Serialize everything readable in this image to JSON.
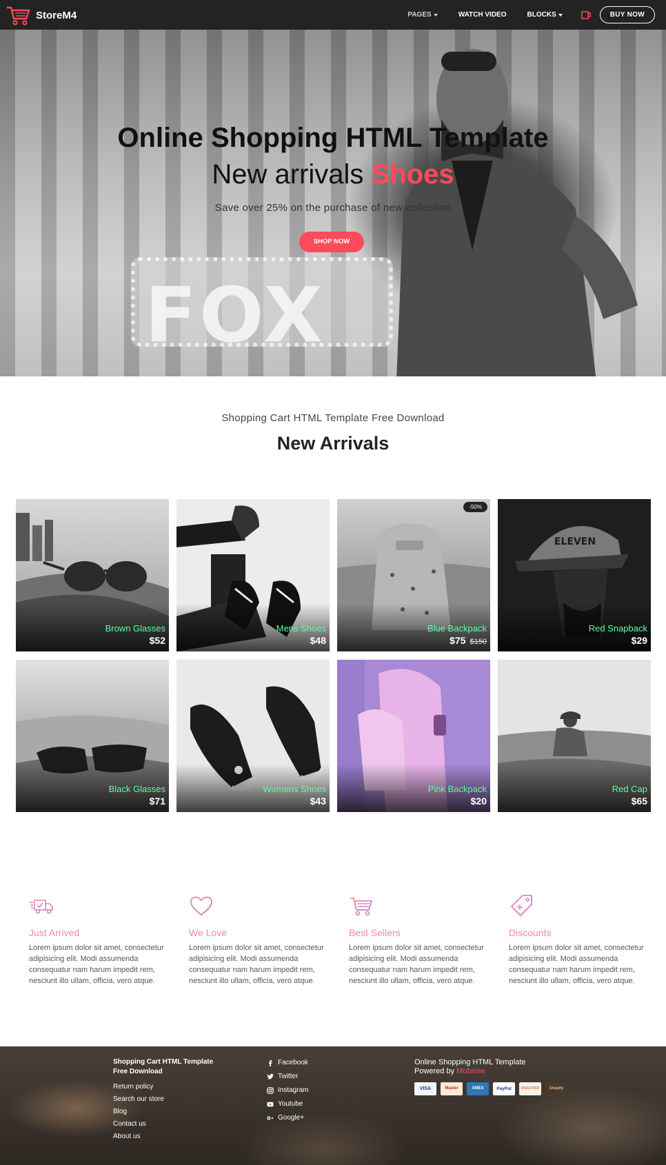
{
  "nav": {
    "brand": "StoreM4",
    "items": [
      {
        "label": "PAGES",
        "dropdown": true
      },
      {
        "label": "WATCH VIDEO",
        "dropdown": false
      },
      {
        "label": "BLOCKS",
        "dropdown": true
      }
    ],
    "buy_label": "BUY NOW"
  },
  "hero": {
    "title": "Online Shopping HTML Template",
    "subtitle_prefix": "New arrivals",
    "subtitle_accent": "Shoes",
    "description": "Save over 25% on the purchase of new collection",
    "button_label": "SHOP NOW",
    "sign_text": "FOX"
  },
  "arrivals": {
    "kicker": "Shopping Cart HTML Template Free Download",
    "title": "New Arrivals",
    "products": [
      {
        "name": "Brown Glasses",
        "price": "$52"
      },
      {
        "name": "Mens Shoes",
        "price": "$48"
      },
      {
        "name": "Blue Backpack",
        "price": "$75",
        "old_price": "$150",
        "badge": "-50%"
      },
      {
        "name": "Red Snapback",
        "price": "$29",
        "cap_text": "ELEVEN"
      },
      {
        "name": "Black Glasses",
        "price": "$71"
      },
      {
        "name": "Womens Shoes",
        "price": "$43"
      },
      {
        "name": "Pink Backpack",
        "price": "$20"
      },
      {
        "name": "Red Cap",
        "price": "$65"
      }
    ]
  },
  "features": [
    {
      "icon": "delivery-truck-icon",
      "title": "Just Arrived",
      "text": "Lorem ipsum dolor sit amet, consectetur adipisicing elit. Modi assumenda consequatur nam harum impedit rem, nesciunt illo ullam, officia, vero atque."
    },
    {
      "icon": "heart-icon",
      "title": "We Love",
      "text": "Lorem ipsum dolor sit amet, consectetur adipisicing elit. Modi assumenda consequatur nam harum impedit rem, nesciunt illo ullam, officia, vero atque."
    },
    {
      "icon": "shopping-cart-icon",
      "title": "Best Sellers",
      "text": "Lorem ipsum dolor sit amet, consectetur adipisicing elit. Modi assumenda consequatur nam harum impedit rem, nesciunt illo ullam, officia, vero atque."
    },
    {
      "icon": "price-tag-icon",
      "title": "Discounts",
      "text": "Lorem ipsum dolor sit amet, consectetur adipisicing elit. Modi assumenda consequatur nam harum impedit rem, nesciunt illo ullam, officia, vero atque."
    }
  ],
  "footer": {
    "col1_title": "Shopping Cart HTML Template Free Download",
    "col1_links": [
      "Return policy",
      "Search our store",
      "Blog",
      "Contact us",
      "About us"
    ],
    "social": [
      {
        "icon": "facebook-icon",
        "label": "Facebook"
      },
      {
        "icon": "twitter-icon",
        "label": "Twitter"
      },
      {
        "icon": "instagram-icon",
        "label": "Instagram"
      },
      {
        "icon": "youtube-icon",
        "label": "Youtube"
      },
      {
        "icon": "google-plus-icon",
        "label": "Google+"
      }
    ],
    "right_title": "Online Shopping HTML Template",
    "powered_prefix": "Powered by",
    "powered_link": "Mobirise",
    "payment_cards": [
      "VISA",
      "Master",
      "AMEX",
      "PayPal",
      "DISCOVER",
      "Shopify"
    ]
  },
  "colors": {
    "accent": "#ff4a5a",
    "product_name": "#5cff9e",
    "feature_title": "#f58a94",
    "nav_bg": "#232323"
  }
}
